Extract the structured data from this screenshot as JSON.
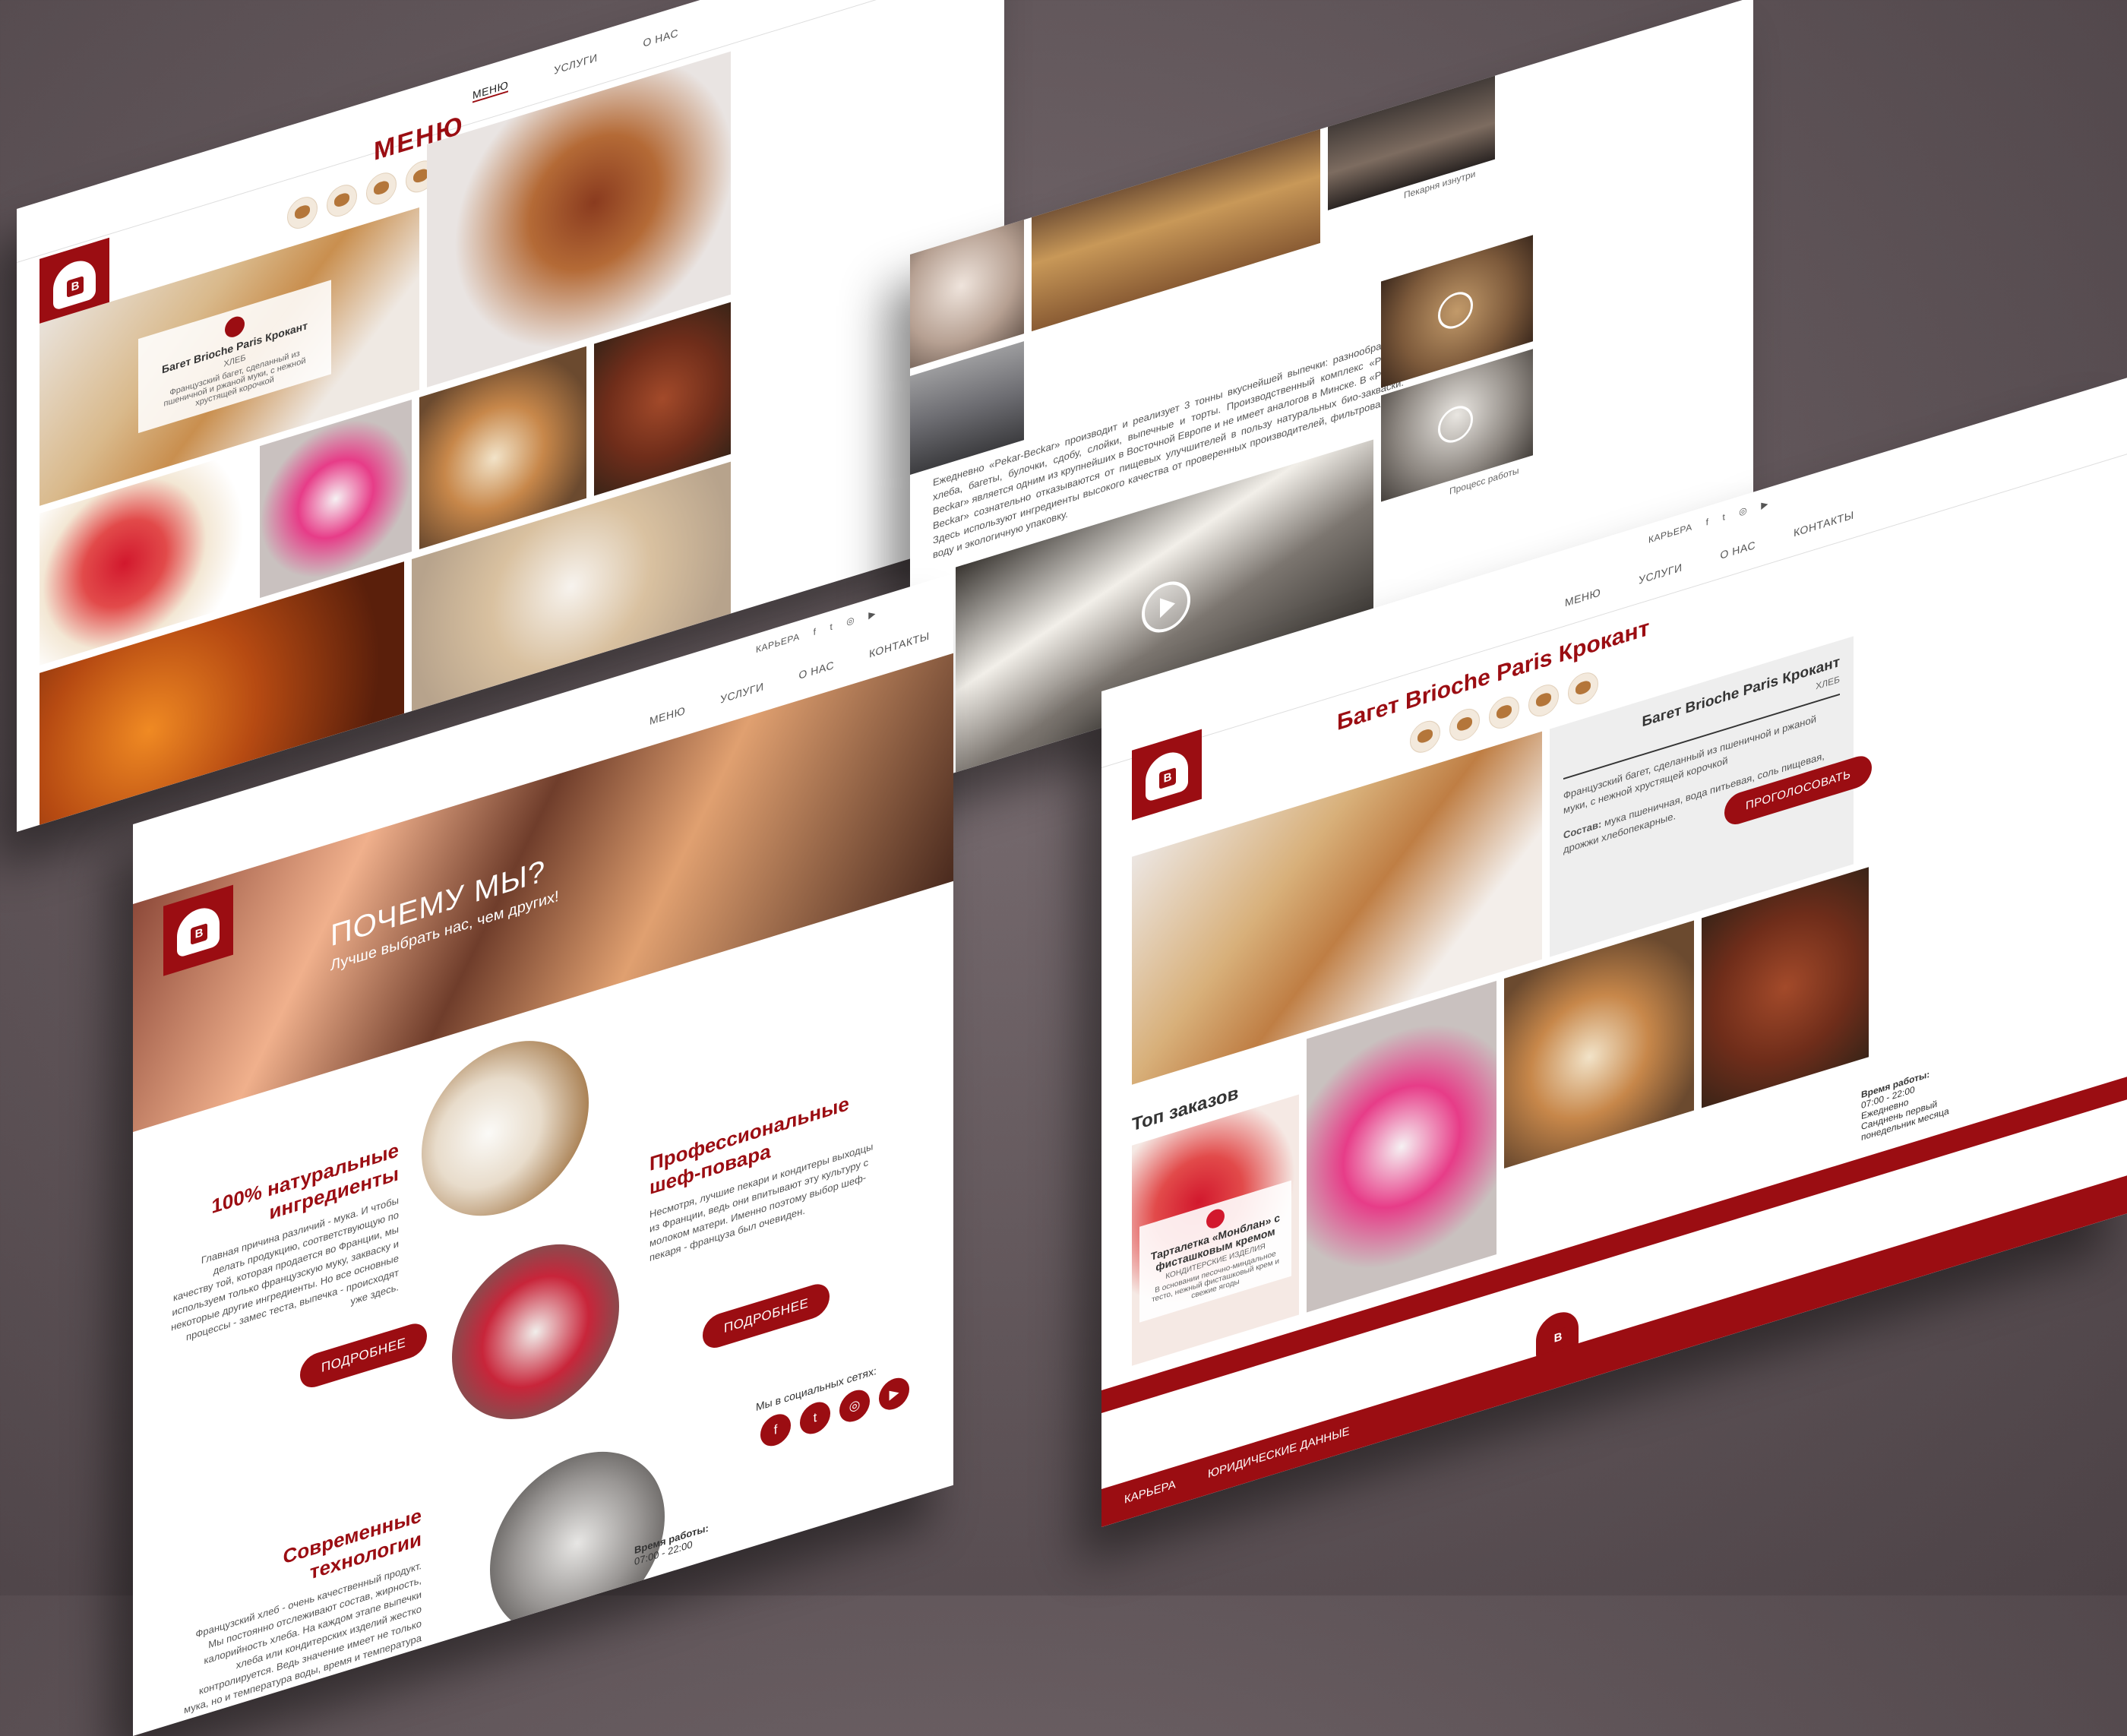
{
  "nav": {
    "menu": "МЕНЮ",
    "services": "УСЛУГИ",
    "about": "О НАС",
    "contacts": "КОНТАКТЫ",
    "career": "КАРЬЕРА"
  },
  "menu_page": {
    "title": "МЕНЮ",
    "overlay_title": "Багет Brioche Paris Крокант",
    "overlay_category": "ХЛЕБ",
    "overlay_desc": "Французский багет, сделанный из пшеничной и ржаной муки, с нежной хрустящей корочкой"
  },
  "about_page": {
    "caption_top": "Пекарня изнутри",
    "text": "Ежедневно «Pekar-Beckar» производит и реализует 3 тонны вкуснейшей выпечки: разнообразные хлеба, багеты, булочки, сдобу, слойки, выпечные и торты. Производственный комплекс «Pekar-Beckar» является одним из крупнейших в Восточной Европе и не имеет аналогов в Минске. В «Pekar-Beckar» сознательно отказываются от пищевых улучшителей в пользу натуральных био-закваски. Здесь используют ингредиенты высокого качества от проверенных производителей, фильтрованную воду и экологичную упаковку.",
    "caption_bottom": "Процесс работы"
  },
  "why_page": {
    "hero_title": "ПОЧЕМУ МЫ?",
    "hero_subtitle": "Лучше выбрать нас, чем других!",
    "f1_title": "100% натуральные ингредиенты",
    "f1_text": "Главная причина различий - мука. И чтобы делать продукцию, соответствующую по качеству той, которая продается во Франции, мы используем только французскую муку, закваску и некоторые другие ингредиенты. Но все основные процессы - замес теста, выпечка - происходят уже здесь.",
    "f2_title": "Профессиональные шеф-повара",
    "f2_text": "Несмотря, лучшие пекари и кондитеры выходцы из Франции, ведь они впитывают эту культуру с молоком матери. Именно поэтому выбор шеф-пекаря - француза был очевиден.",
    "f3_title": "Современные технологии",
    "f3_text": "Французский хлеб - очень качественный продукт. Мы постоянно отслеживают состав, жирность, калорийность хлеба. На каждом этапе выпечки хлеба или кондитерских изделий жестко контролируется. Ведь значение имеет не только мука, но и температура воды, время и температура в печи, влажность воздуха.",
    "more": "ПОДРОБНЕЕ",
    "social_label": "Мы в социальных сетях:",
    "hours_label": "Время работы:",
    "hours": "07:00 - 22:00"
  },
  "product_page": {
    "title": "Багет Brioche Paris Крокант",
    "card_title": "Багет Brioche Paris Крокант",
    "card_category": "ХЛЕБ",
    "card_desc": "Французский багет, сделанный из пшеничной и ржаной муки, с нежной хрустящей корочкой",
    "card_comp_label": "Состав:",
    "card_comp": "мука пшеничная, вода питьевая, соль пищевая, дрожжи хлебопекарные.",
    "vote": "ПРОГОЛОСОВАТЬ",
    "top_orders": "Топ заказов",
    "tart_title": "Тарталетка «Монблан» с фисташковым кремом",
    "tart_category": "КОНДИТЕРСКИЕ ИЗДЕЛИЯ",
    "tart_desc": "В основании песочно-миндальное тесто, нежный фисташковый крем и свежие ягоды",
    "hours_label": "Время работы:",
    "hours_1": "07:00 - 22:00",
    "hours_2": "Ежедневно",
    "hours_3": "Санднень первый понедельник месяца",
    "footer_career": "КАРЬЕРА",
    "footer_legal": "ЮРИДИЧЕСКИЕ ДАННЫЕ"
  },
  "colors": {
    "brand": "#9b0d12",
    "bg": "#5f5458"
  },
  "icons": [
    "croissant-icon",
    "bread-icon",
    "cake-icon",
    "pie-icon",
    "cookie-icon"
  ]
}
